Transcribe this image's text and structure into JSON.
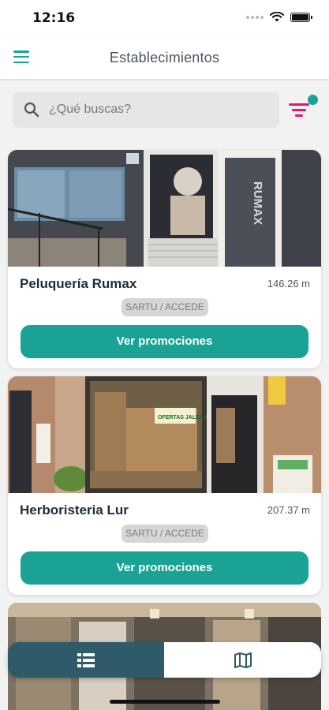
{
  "status_bar": {
    "time": "12:16"
  },
  "header": {
    "title": "Establecimientos"
  },
  "search": {
    "placeholder": "¿Qué buscas?"
  },
  "establishments": [
    {
      "name": "Peluquería Rumax",
      "distance": "146.26 m",
      "badge": "SARTU / ACCEDE",
      "button_label": "Ver promociones",
      "photo_sign": "RUMAX"
    },
    {
      "name": "Herboristeria Lur",
      "distance": "207.37 m",
      "badge": "SARTU / ACCEDE",
      "button_label": "Ver promociones",
      "photo_sign": "OFERTAS JALEA REAL"
    }
  ],
  "colors": {
    "accent": "#1aa394",
    "filter": "#e0176b",
    "toggle_active": "#2e5a6a"
  },
  "view_toggle": {
    "list_icon": "list-icon",
    "map_icon": "map-icon",
    "active": "list"
  }
}
